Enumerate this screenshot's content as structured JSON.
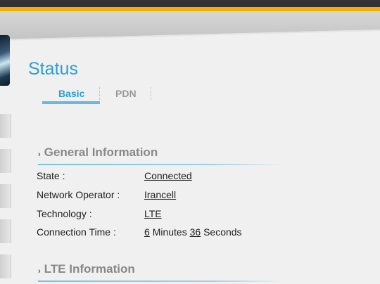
{
  "page": {
    "title": "Status"
  },
  "tabs": [
    {
      "label": "Basic",
      "active": true
    },
    {
      "label": "PDN",
      "active": false
    }
  ],
  "sections": {
    "general": {
      "title": "General Information"
    },
    "lte": {
      "title": "LTE Information"
    }
  },
  "general_info": {
    "state_label": "State :",
    "state_value": "Connected",
    "operator_label": "Network Operator :",
    "operator_value": "Irancell",
    "technology_label": "Technology :",
    "technology_value": "LTE",
    "connection_time_label": "Connection Time :",
    "connection_time": {
      "minutes": "6",
      "minutes_unit": "Minutes",
      "seconds": "36",
      "seconds_unit": "Seconds"
    }
  },
  "colors": {
    "accent": "#f2b000",
    "title_blue": "#2a9fd0",
    "tab_underline": "#6ab8de",
    "section_heading": "#888888",
    "top_bar": "#333333"
  },
  "icons": {
    "section_chevron": "chevron-right-icon",
    "logo": "logo-image"
  }
}
